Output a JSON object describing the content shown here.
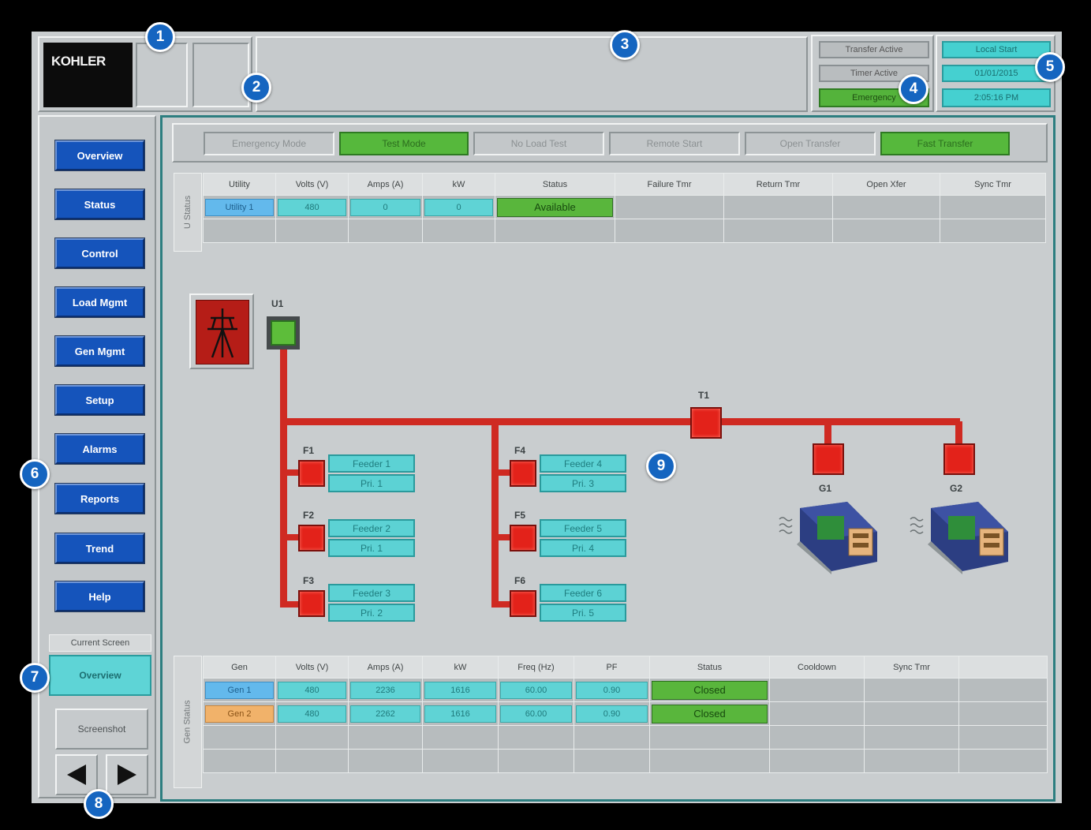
{
  "header": {
    "logo_text": "KOHLER",
    "indicators_left": [
      "Transfer Active",
      "Timer Active",
      "Emergency"
    ],
    "indicators_right": [
      "Local Start",
      "01/01/2015",
      "2:05:16 PM"
    ]
  },
  "sidebar": {
    "items": [
      {
        "label": "Overview"
      },
      {
        "label": "Status"
      },
      {
        "label": "Control"
      },
      {
        "label": "Load Mgmt"
      },
      {
        "label": "Gen Mgmt"
      },
      {
        "label": "Setup"
      },
      {
        "label": "Alarms"
      },
      {
        "label": "Reports"
      },
      {
        "label": "Trend"
      },
      {
        "label": "Help"
      }
    ],
    "current_screen_label": "Current Screen",
    "current_screen_value": "Overview",
    "screenshot_label": "Screenshot"
  },
  "modes": [
    {
      "label": "Emergency Mode",
      "active": false
    },
    {
      "label": "Test Mode",
      "active": true
    },
    {
      "label": "No Load Test",
      "active": false
    },
    {
      "label": "Remote Start",
      "active": false
    },
    {
      "label": "Open Transfer",
      "active": false
    },
    {
      "label": "Fast Transfer",
      "active": true
    }
  ],
  "utility_status": {
    "side_label": "U Status",
    "headers": [
      "Utility",
      "Volts (V)",
      "Amps (A)",
      "kW",
      "Status",
      "Failure Tmr",
      "Return Tmr",
      "Open Xfer",
      "Sync Tmr"
    ],
    "rows": [
      {
        "name": "Utility 1",
        "volts": "480",
        "amps": "0",
        "kw": "0",
        "status": "Available"
      }
    ]
  },
  "one_line": {
    "utility_label": "U1",
    "tie_label": "T1",
    "feeders": [
      {
        "id": "F1",
        "name": "Feeder 1",
        "priority": "Pri. 1"
      },
      {
        "id": "F2",
        "name": "Feeder 2",
        "priority": "Pri. 1"
      },
      {
        "id": "F3",
        "name": "Feeder 3",
        "priority": "Pri. 2"
      },
      {
        "id": "F4",
        "name": "Feeder 4",
        "priority": "Pri. 3"
      },
      {
        "id": "F5",
        "name": "Feeder 5",
        "priority": "Pri. 4"
      },
      {
        "id": "F6",
        "name": "Feeder 6",
        "priority": "Pri. 5"
      }
    ],
    "generators": [
      {
        "label": "G1"
      },
      {
        "label": "G2"
      }
    ]
  },
  "gen_status": {
    "side_label": "Gen Status",
    "headers": [
      "Gen",
      "Volts (V)",
      "Amps (A)",
      "kW",
      "Freq (Hz)",
      "PF",
      "Status",
      "Cooldown",
      "Sync Tmr"
    ],
    "rows": [
      {
        "name": "Gen 1",
        "volts": "480",
        "amps": "2236",
        "kw": "1616",
        "freq": "60.00",
        "pf": "0.90",
        "status": "Closed"
      },
      {
        "name": "Gen 2",
        "volts": "480",
        "amps": "2262",
        "kw": "1616",
        "freq": "60.00",
        "pf": "0.90",
        "status": "Closed"
      }
    ]
  },
  "callouts": [
    "1",
    "2",
    "3",
    "4",
    "5",
    "6",
    "7",
    "8",
    "9"
  ],
  "colors": {
    "nav_blue": "#1554bb",
    "active_green": "#56b83c",
    "value_cyan": "#5fd3d5",
    "bus_red": "#cf2a22",
    "frame_teal": "#2d7e80",
    "callout_blue": "#1565c0"
  }
}
